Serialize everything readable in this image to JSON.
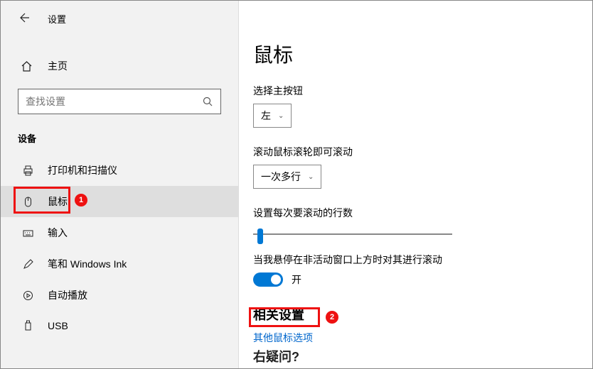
{
  "app_title": "设置",
  "home_label": "主页",
  "search_placeholder": "查找设置",
  "section_label": "设备",
  "nav": [
    {
      "label": "打印机和扫描仪",
      "icon": "printer-icon"
    },
    {
      "label": "鼠标",
      "icon": "mouse-icon",
      "selected": true
    },
    {
      "label": "输入",
      "icon": "keyboard-icon"
    },
    {
      "label": "笔和 Windows Ink",
      "icon": "pen-icon"
    },
    {
      "label": "自动播放",
      "icon": "autoplay-icon"
    },
    {
      "label": "USB",
      "icon": "usb-icon"
    }
  ],
  "right": {
    "title": "鼠标",
    "primary_button_label": "选择主按钮",
    "primary_button_value": "左",
    "scroll_label": "滚动鼠标滚轮即可滚动",
    "scroll_value": "一次多行",
    "lines_label": "设置每次要滚动的行数",
    "hover_label": "当我悬停在非活动窗口上方时对其进行滚动",
    "toggle_state": "开",
    "related_title": "相关设置",
    "other_mouse_link": "其他鼠标选项",
    "bottom_peek": "右疑问?"
  },
  "annotation": {
    "badge1": "1",
    "badge2": "2"
  }
}
